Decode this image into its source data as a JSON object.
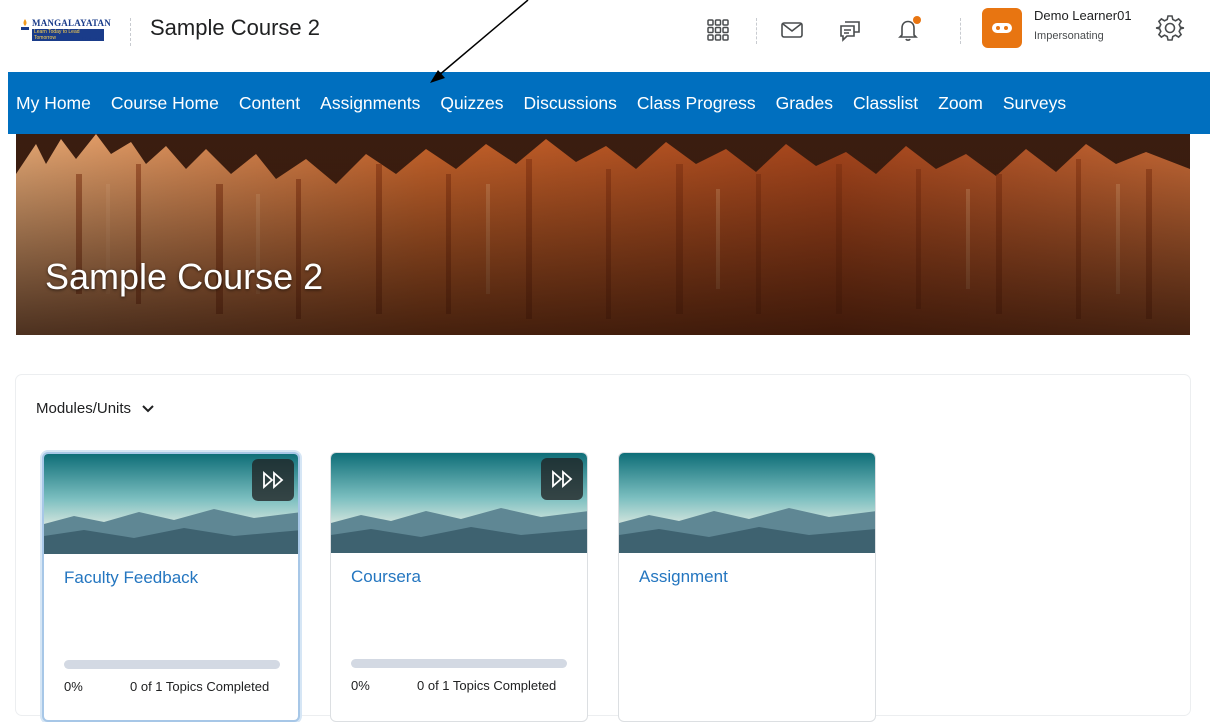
{
  "topbar": {
    "logo": {
      "brand": "MANGALAYATAN",
      "tagline": "Learn Today to Lead Tomorrow",
      "sub": "Online"
    },
    "course_title": "Sample Course 2",
    "icons": [
      "waffle-grid-icon",
      "mail-icon",
      "chat-icon",
      "bell-icon",
      "gear-icon"
    ],
    "user": {
      "name": "Demo Learner01",
      "role": "Impersonating"
    },
    "colors": {
      "notification": "#e87511",
      "avatar": "#e87511"
    }
  },
  "nav": {
    "color": "#006fbf",
    "items": [
      "My Home",
      "Course Home",
      "Content",
      "Assignments",
      "Quizzes",
      "Discussions",
      "Class Progress",
      "Grades",
      "Classlist",
      "Zoom",
      "Surveys"
    ]
  },
  "banner": {
    "title": "Sample Course 2"
  },
  "modules": {
    "dropdown_label": "Modules/Units",
    "cards": [
      {
        "title": "Faculty Feedback",
        "percent": "0%",
        "topics": "0 of 1 Topics Completed",
        "progress": 0
      },
      {
        "title": "Coursera",
        "percent": "0%",
        "topics": "0 of 1 Topics Completed",
        "progress": 0
      },
      {
        "title": "Assignment"
      }
    ]
  }
}
